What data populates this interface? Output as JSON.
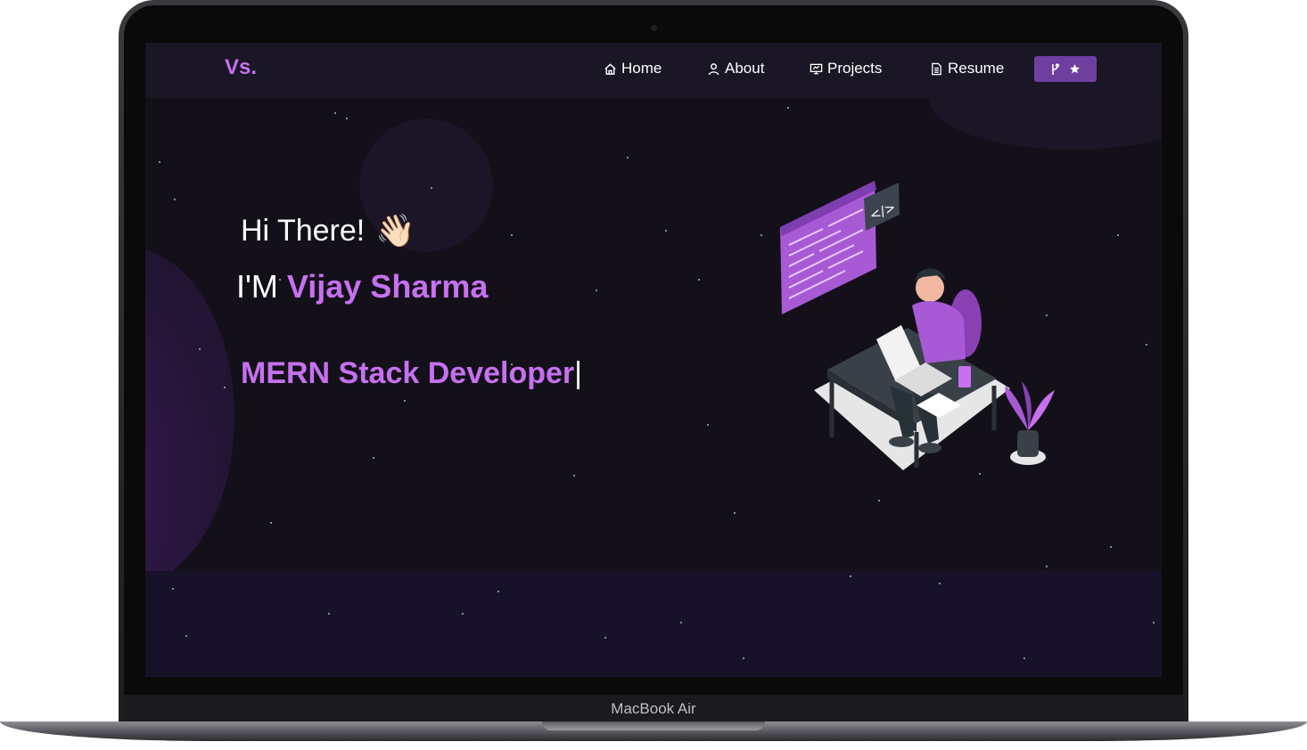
{
  "device": {
    "label": "MacBook Air"
  },
  "navbar": {
    "logo": "Vs.",
    "items": [
      {
        "label": "Home",
        "icon": "home-icon"
      },
      {
        "label": "About",
        "icon": "user-icon"
      },
      {
        "label": "Projects",
        "icon": "presentation-icon"
      },
      {
        "label": "Resume",
        "icon": "document-icon"
      }
    ],
    "github_button": {
      "icons": [
        "git-fork-icon",
        "star-icon"
      ]
    }
  },
  "hero": {
    "greeting": "Hi There!",
    "wave_emoji": "👋🏻",
    "intro_prefix": "I'M",
    "name": "Vijay Sharma",
    "role": "MERN Stack Developer",
    "cursor": "|"
  },
  "colors": {
    "accent": "#c770f0",
    "background": "#131019",
    "navbar": "#1a1626",
    "button": "#6f3fa0"
  }
}
